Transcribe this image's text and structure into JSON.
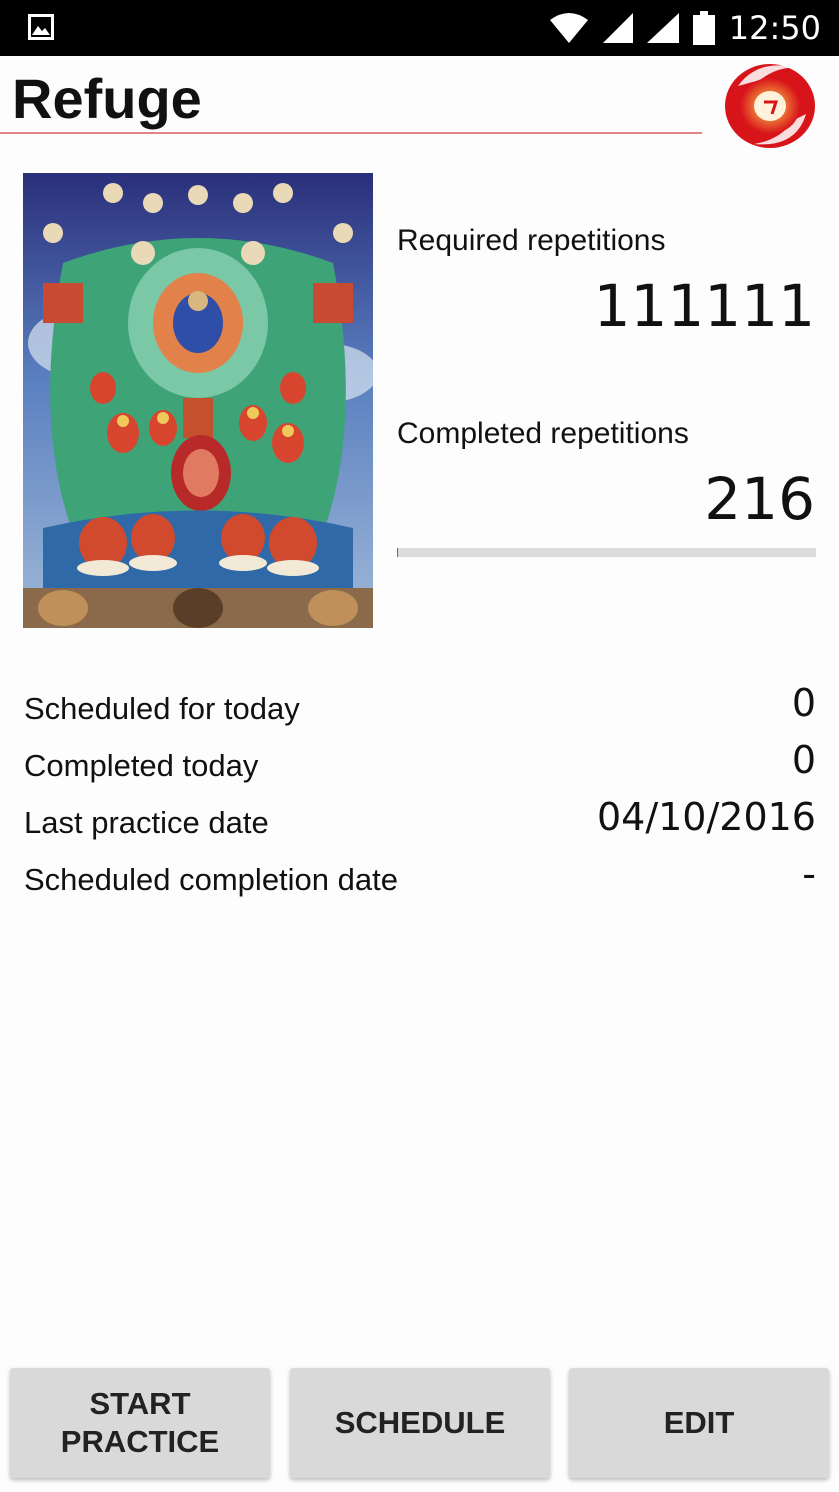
{
  "status_bar": {
    "time": "12:50",
    "icons": [
      "gallery-notification-icon",
      "wifi-icon",
      "signal-icon",
      "signal-icon",
      "battery-icon"
    ]
  },
  "header": {
    "title": "Refuge",
    "logo_icon": "red-spiral-logo",
    "accent_color": "#e53935"
  },
  "stats": {
    "required_label": "Required repetitions",
    "required_value": "111111",
    "completed_label": "Completed repetitions",
    "completed_value": "216",
    "progress_fraction": 0.0019
  },
  "details": [
    {
      "label": "Scheduled for today",
      "value": "0"
    },
    {
      "label": "Completed today",
      "value": "0"
    },
    {
      "label": "Last practice date",
      "value": "04/10/2016"
    },
    {
      "label": "Scheduled completion date",
      "value": "-"
    }
  ],
  "buttons": {
    "start_practice": "START PRACTICE",
    "schedule": "SCHEDULE",
    "edit": "EDIT"
  }
}
